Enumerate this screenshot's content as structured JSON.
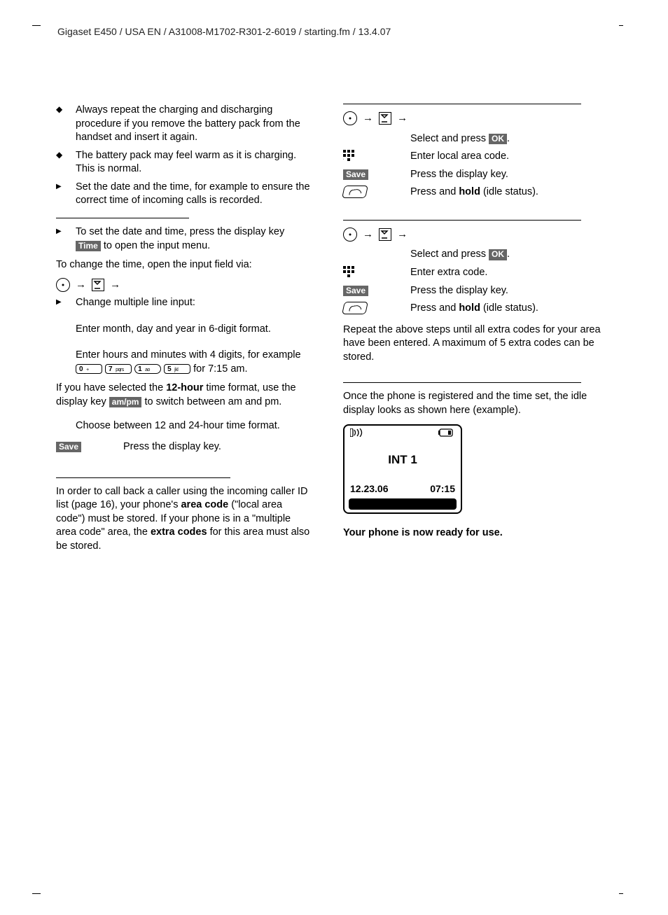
{
  "header": "Gigaset E450 / USA EN / A31008-M1702-R301-2-6019 / starting.fm / 13.4.07",
  "left": {
    "b1": "Always repeat the charging and discharging procedure if you remove the battery pack from the handset and insert it again.",
    "b2": "The battery pack may feel warm as it is charging. This is normal.",
    "b3": "Set the date and the time, for example to ensure the correct time of incoming calls is recorded.",
    "dt1_a": "To set the date and time, press the display key ",
    "dt1_key": "Time",
    "dt1_b": " to open the input menu.",
    "change_time": "To change the time, open the input field via:",
    "cm_line": "Change multiple line input:",
    "enter_mdy": "Enter month, day and year in 6-digit format.",
    "enter_hm_a": "Enter hours and minutes with 4 digits, for example ",
    "k0": "0",
    "k0s": "+",
    "k7": "7",
    "k7s": "pqrs",
    "k1": "1",
    "k1s": "ao",
    "k5": "5",
    "k5s": "jkl",
    "enter_hm_b": " for 7:15 am.",
    "tw_a": "If you have selected the ",
    "tw_b": "12-hour",
    "tw_c": " time format, use the display key ",
    "tw_key": "am/pm",
    "tw_d": " to switch between am and pm.",
    "choose_fmt": "Choose between 12 and 24-hour time format.",
    "save_key": "Save",
    "save_txt": "Press the display key.",
    "area_a": "In order to call back a caller using the incoming caller ID list (page 16), your phone's ",
    "area_b": "area code",
    "area_c": " (\"local area code\") must be stored. If your phone is in a \"multiple area code\" area, the ",
    "area_d": "extra codes",
    "area_e": " for this area must also be stored."
  },
  "right": {
    "sel_ok_a": "Select and press ",
    "ok_key": "OK",
    "sel_ok_b": ".",
    "enter_local": "Enter local area code.",
    "save_key": "Save",
    "press_disp": "Press the display key.",
    "hold_a": "Press and ",
    "hold_b": "hold",
    "hold_c": " (idle status).",
    "enter_extra": "Enter extra code.",
    "repeat": "Repeat the above steps until all extra codes for your area have been entered. A maximum of 5 extra codes can be stored.",
    "once": "Once the phone is registered and the time set, the idle display looks as shown here (example).",
    "disp_name": "INT 1",
    "disp_date": "12.23.06",
    "disp_time": "07:15",
    "ready": "Your phone is now ready for use."
  }
}
